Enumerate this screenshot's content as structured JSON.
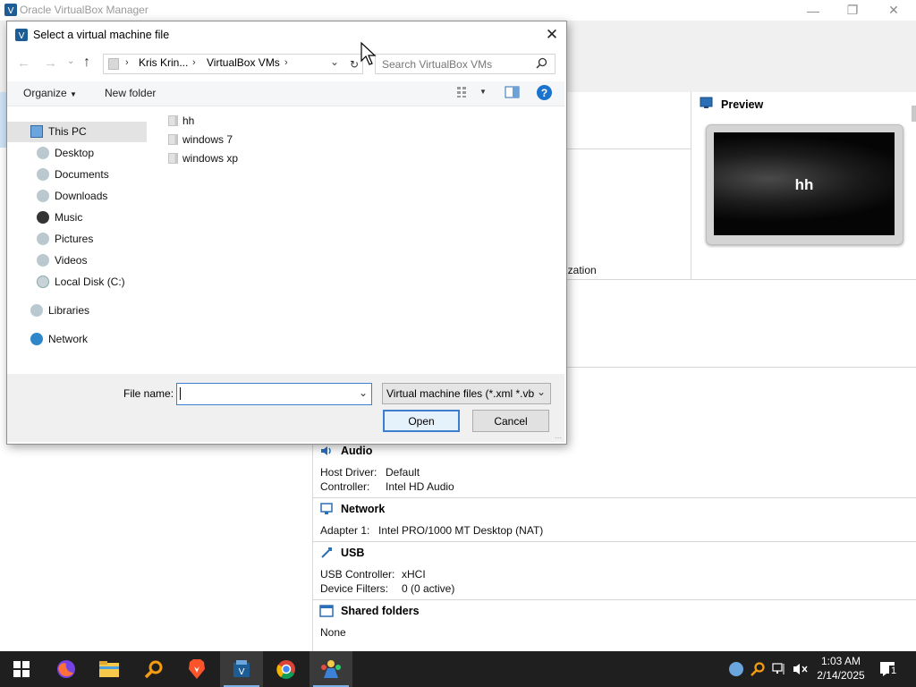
{
  "background_app": {
    "title": "Oracle VirtualBox Manager",
    "partial_label": "ization",
    "preview": {
      "label": "Preview",
      "vm_name": "hh"
    },
    "sections": [
      {
        "title": "Audio",
        "rows": [
          {
            "key": "Host Driver:",
            "value": "Default"
          },
          {
            "key": "Controller:",
            "value": "Intel HD Audio"
          }
        ]
      },
      {
        "title": "Network",
        "rows": [
          {
            "key": "Adapter 1:",
            "value": "Intel PRO/1000 MT Desktop (NAT)"
          }
        ]
      },
      {
        "title": "USB",
        "rows": [
          {
            "key": "USB Controller:",
            "value": "xHCI"
          },
          {
            "key": "Device Filters:",
            "value": "0 (0 active)"
          }
        ]
      },
      {
        "title": "Shared folders",
        "rows": [
          {
            "key": "None",
            "value": ""
          }
        ]
      }
    ]
  },
  "dialog": {
    "title": "Select a virtual machine file",
    "breadcrumb": [
      "Kris Krin...",
      "VirtualBox VMs"
    ],
    "search_placeholder": "Search VirtualBox VMs",
    "commands": {
      "organize": "Organize",
      "new_folder": "New folder"
    },
    "nav": {
      "this_pc": "This PC",
      "items": [
        "Desktop",
        "Documents",
        "Downloads",
        "Music",
        "Pictures",
        "Videos",
        "Local Disk (C:)"
      ],
      "libraries": "Libraries",
      "network": "Network"
    },
    "files": [
      "hh",
      "windows 7",
      "windows xp"
    ],
    "file_name_label": "File name:",
    "file_name_value": "",
    "file_type": "Virtual machine files (*.xml *.vb",
    "open_label": "Open",
    "cancel_label": "Cancel"
  },
  "taskbar": {
    "apps": [
      "windows-start",
      "firefox",
      "file-explorer",
      "search-tool",
      "brave",
      "virtualbox",
      "chrome",
      "app-people"
    ],
    "time": "1:03 AM",
    "date": "2/14/2025",
    "notification_count": "1"
  },
  "colors": {
    "accent": "#3c7fcf",
    "taskbar": "#1f1f1f",
    "dialog_bottom": "#f0f0f0"
  }
}
